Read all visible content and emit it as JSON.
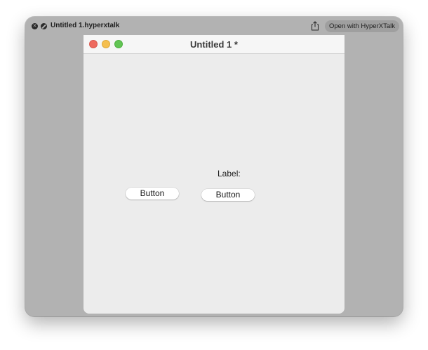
{
  "quicklook": {
    "filename": "Untitled 1.hyperxtalk",
    "open_button": "Open with HyperXTalk",
    "icons": [
      "close-icon",
      "block-icon",
      "share-icon"
    ]
  },
  "app_window": {
    "title": "Untitled 1 *",
    "traffic_lights": [
      "#ee6a5f",
      "#f5bf4f",
      "#62c554"
    ]
  },
  "canvas": {
    "label": "Label:",
    "buttons": [
      {
        "label": "Button"
      },
      {
        "label": "Button"
      }
    ]
  },
  "colors": {
    "quicklook_background": "#b2b2b2",
    "canvas_background": "#ececec"
  }
}
